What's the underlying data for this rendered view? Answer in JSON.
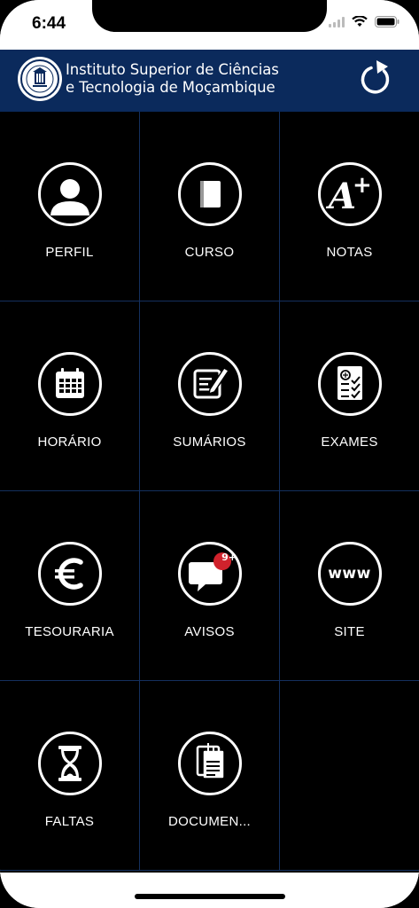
{
  "status": {
    "time": "6:44"
  },
  "header": {
    "title_line1": "Instituto Superior de Ciências",
    "title_line2": "e Tecnologia de Moçambique"
  },
  "tiles": [
    {
      "label": "PERFIL",
      "icon": "profile-icon"
    },
    {
      "label": "CURSO",
      "icon": "book-icon"
    },
    {
      "label": "NOTAS",
      "icon": "grade-a-plus-icon"
    },
    {
      "label": "HORÁRIO",
      "icon": "calendar-icon"
    },
    {
      "label": "SUMÁRIOS",
      "icon": "notes-pen-icon"
    },
    {
      "label": "EXAMES",
      "icon": "exam-checklist-icon"
    },
    {
      "label": "TESOURARIA",
      "icon": "euro-icon"
    },
    {
      "label": "AVISOS",
      "icon": "chat-notification-icon",
      "badge": "9+"
    },
    {
      "label": "SITE",
      "icon": "www-icon",
      "icon_text": "www"
    },
    {
      "label": "FALTAS",
      "icon": "hourglass-icon"
    },
    {
      "label": "DOCUMEN...",
      "icon": "documents-clip-icon"
    }
  ],
  "colors": {
    "header_bg": "#0b2a5c",
    "grid_bg": "#000000",
    "divider": "#14305e",
    "badge": "#d0222c"
  }
}
